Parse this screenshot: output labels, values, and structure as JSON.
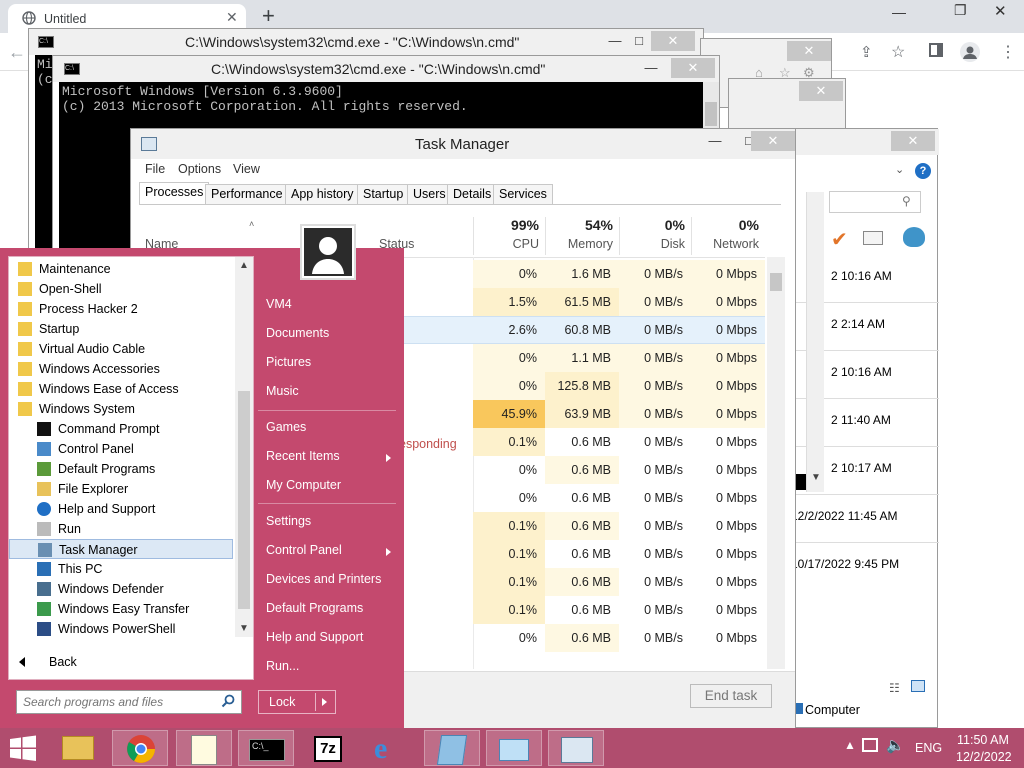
{
  "browser": {
    "tab_title": "Untitled",
    "new_tab_label": "+"
  },
  "cmd": {
    "title": "C:\\Windows\\system32\\cmd.exe - \"C:\\Windows\\n.cmd\"",
    "line1": "Microsoft Windows [Version 6.3.9600]",
    "line2": "(c) 2013 Microsoft Corporation. All rights reserved.",
    "behind_frag": "Mi\n(c"
  },
  "taskmgr": {
    "title": "Task Manager",
    "menu": [
      "File",
      "Options",
      "View"
    ],
    "tabs": [
      "Processes",
      "Performance",
      "App history",
      "Startup",
      "Users",
      "Details",
      "Services"
    ],
    "col_name": "Name",
    "col_status": "Status",
    "cpu": {
      "pct": "99%",
      "label": "CPU"
    },
    "memory": {
      "pct": "54%",
      "label": "Memory"
    },
    "disk": {
      "pct": "0%",
      "label": "Disk"
    },
    "network": {
      "pct": "0%",
      "label": "Network"
    },
    "status_fragment": "esponding",
    "rows": [
      {
        "cpu": "0%",
        "mem": "1.6 MB",
        "disk": "0 MB/s",
        "net": "0 Mbps"
      },
      {
        "cpu": "1.5%",
        "mem": "61.5 MB",
        "disk": "0 MB/s",
        "net": "0 Mbps"
      },
      {
        "cpu": "2.6%",
        "mem": "60.8 MB",
        "disk": "0 MB/s",
        "net": "0 Mbps"
      },
      {
        "cpu": "0%",
        "mem": "1.1 MB",
        "disk": "0 MB/s",
        "net": "0 Mbps"
      },
      {
        "cpu": "0%",
        "mem": "125.8 MB",
        "disk": "0 MB/s",
        "net": "0 Mbps"
      },
      {
        "cpu": "45.9%",
        "mem": "63.9 MB",
        "disk": "0 MB/s",
        "net": "0 Mbps"
      },
      {
        "cpu": "0.1%",
        "mem": "0.6 MB",
        "disk": "0 MB/s",
        "net": "0 Mbps"
      },
      {
        "cpu": "0%",
        "mem": "0.6 MB",
        "disk": "0 MB/s",
        "net": "0 Mbps"
      },
      {
        "cpu": "0%",
        "mem": "0.6 MB",
        "disk": "0 MB/s",
        "net": "0 Mbps"
      },
      {
        "cpu": "0.1%",
        "mem": "0.6 MB",
        "disk": "0 MB/s",
        "net": "0 Mbps"
      },
      {
        "cpu": "0.1%",
        "mem": "0.6 MB",
        "disk": "0 MB/s",
        "net": "0 Mbps"
      },
      {
        "cpu": "0.1%",
        "mem": "0.6 MB",
        "disk": "0 MB/s",
        "net": "0 Mbps"
      },
      {
        "cpu": "0.1%",
        "mem": "0.6 MB",
        "disk": "0 MB/s",
        "net": "0 Mbps"
      },
      {
        "cpu": "0%",
        "mem": "0.6 MB",
        "disk": "0 MB/s",
        "net": "0 Mbps"
      }
    ],
    "end_task": "End task"
  },
  "explorer": {
    "dates": [
      "2 10:16 AM",
      "2 2:14 AM",
      "2 10:16 AM",
      "2 11:40 AM",
      "2 10:17 AM",
      "12/2/2022 11:45 AM",
      "10/17/2022 9:45 PM"
    ],
    "computer_label": "Computer"
  },
  "start": {
    "programs": [
      {
        "label": "Maintenance",
        "icon": "folder-icon",
        "sub": false
      },
      {
        "label": "Open-Shell",
        "icon": "folder-icon",
        "sub": false
      },
      {
        "label": "Process Hacker 2",
        "icon": "folder-icon",
        "sub": false
      },
      {
        "label": "Startup",
        "icon": "folder-icon",
        "sub": false
      },
      {
        "label": "Virtual Audio Cable",
        "icon": "folder-icon",
        "sub": false
      },
      {
        "label": "Windows Accessories",
        "icon": "folder-icon",
        "sub": false
      },
      {
        "label": "Windows Ease of Access",
        "icon": "folder-icon",
        "sub": false
      },
      {
        "label": "Windows System",
        "icon": "folder-icon",
        "sub": false
      },
      {
        "label": "Command Prompt",
        "icon": "cmd-icon",
        "sub": true
      },
      {
        "label": "Control Panel",
        "icon": "control-panel-icon",
        "sub": true
      },
      {
        "label": "Default Programs",
        "icon": "default-programs-icon",
        "sub": true
      },
      {
        "label": "File Explorer",
        "icon": "file-explorer-icon",
        "sub": true
      },
      {
        "label": "Help and Support",
        "icon": "help-icon",
        "sub": true
      },
      {
        "label": "Run",
        "icon": "run-icon",
        "sub": true
      },
      {
        "label": "Task Manager",
        "icon": "task-manager-icon",
        "sub": true,
        "selected": true
      },
      {
        "label": "This PC",
        "icon": "this-pc-icon",
        "sub": true
      },
      {
        "label": "Windows Defender",
        "icon": "defender-icon",
        "sub": true
      },
      {
        "label": "Windows Easy Transfer",
        "icon": "easy-transfer-icon",
        "sub": true
      },
      {
        "label": "Windows PowerShell",
        "icon": "powershell-icon",
        "sub": true
      }
    ],
    "back_label": "Back",
    "search_placeholder": "Search programs and files",
    "right_links": [
      {
        "label": "VM4",
        "arrow": false
      },
      {
        "label": "Documents",
        "arrow": false
      },
      {
        "label": "Pictures",
        "arrow": false
      },
      {
        "label": "Music",
        "arrow": false
      },
      {
        "label": "Games",
        "arrow": false
      },
      {
        "label": "Recent Items",
        "arrow": true
      },
      {
        "label": "My Computer",
        "arrow": false
      },
      {
        "label": "Settings",
        "arrow": false
      },
      {
        "label": "Control Panel",
        "arrow": true
      },
      {
        "label": "Devices and Printers",
        "arrow": false
      },
      {
        "label": "Default Programs",
        "arrow": false
      },
      {
        "label": "Help and Support",
        "arrow": false
      },
      {
        "label": "Run...",
        "arrow": false
      }
    ],
    "lock_label": "Lock"
  },
  "taskbar": {
    "apps": [
      "file-explorer-icon",
      "chrome-icon",
      "notepad-icon",
      "cmd-icon",
      "7zip-icon",
      "ie-icon",
      "app-icon",
      "window-icon",
      "task-manager-icon"
    ],
    "lang": "ENG",
    "time": "11:50 AM",
    "date": "12/2/2022"
  },
  "colors": {
    "start_bg": "#c4496e",
    "taskbar_bg": "#b04d6e",
    "cpu_hot": "#f9c75c",
    "cpu_warm": "#fdf1cc",
    "cpu_light": "#fef8e2",
    "selected_row": "#e5f1fb"
  }
}
